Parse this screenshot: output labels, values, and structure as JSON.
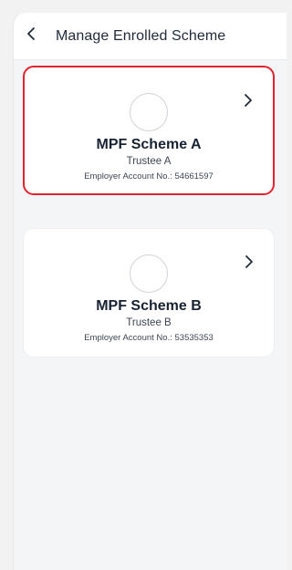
{
  "header": {
    "title": "Manage Enrolled Scheme",
    "back_icon": "chevron-left-icon"
  },
  "schemes": [
    {
      "name": "MPF Scheme A",
      "trustee": "Trustee A",
      "account_label": "Employer Account No.:",
      "account_number": "54661597",
      "selected": true
    },
    {
      "name": "MPF Scheme B",
      "trustee": "Trustee B",
      "account_label": "Employer Account No.:",
      "account_number": "53535353",
      "selected": false
    }
  ],
  "colors": {
    "accent_selected_border": "#e0232f",
    "text_primary": "#172233",
    "background": "#f4f5f7"
  }
}
